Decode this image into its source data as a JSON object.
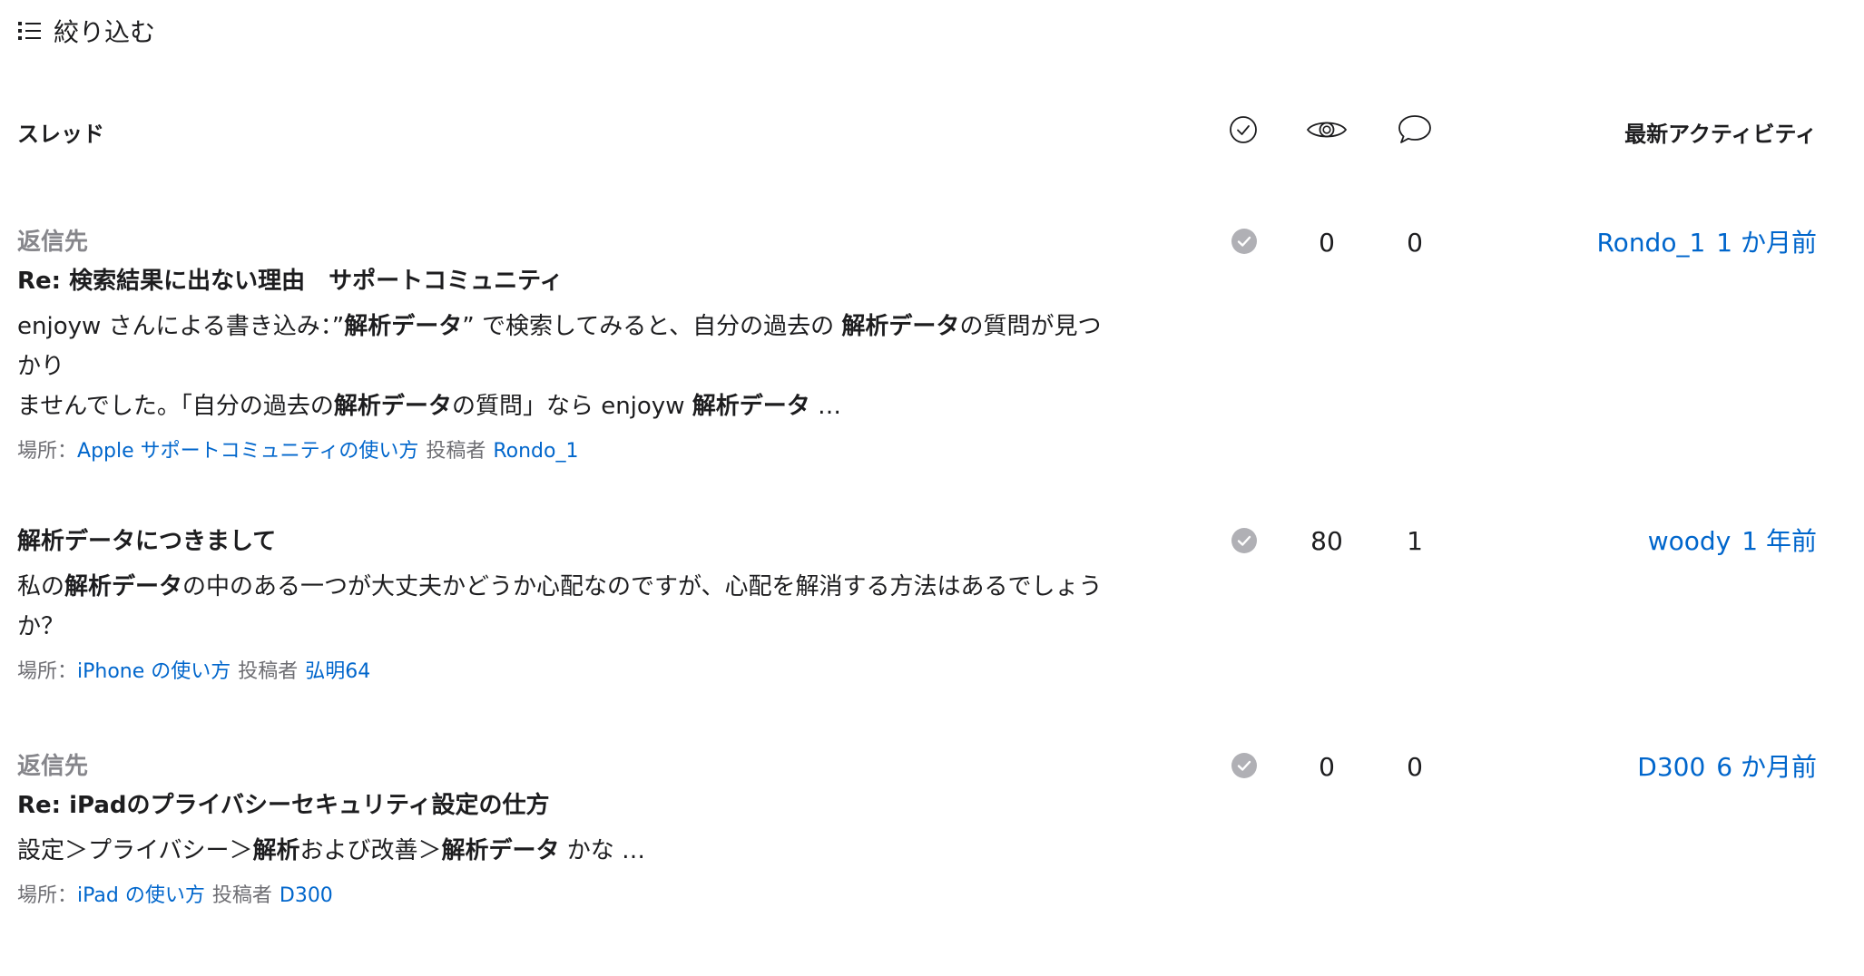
{
  "filter": {
    "label": "絞り込む",
    "icon": "list-filter-icon"
  },
  "header": {
    "thread": "スレッド",
    "solved_icon": "check-circle-icon",
    "views_icon": "eye-icon",
    "replies_icon": "speech-bubble-icon",
    "latest": "最新アクティビティ"
  },
  "colors": {
    "link": "#0066cc",
    "muted": "#86868b",
    "text": "#1d1d1f",
    "badge": "#b0b0b5"
  },
  "threads": [
    {
      "reply_to": "返信先",
      "title": "Re: 検索結果に出ない理由　サポートコミュニティ",
      "excerpt": [
        [
          "enjoyw さんによる書き込み：”",
          false
        ],
        [
          "解析データ",
          true
        ],
        [
          "” で検索してみると、自分の過去の ",
          false
        ],
        [
          "解析データ",
          true
        ],
        [
          "の質問が見つかり",
          false
        ],
        [
          "\nませんでした。「自分の過去の",
          false
        ],
        [
          "解析データ",
          true
        ],
        [
          "の質問」なら enjoyw ",
          false
        ],
        [
          "解析データ",
          true
        ],
        [
          " …",
          false
        ]
      ],
      "location_label": "場所：",
      "location": "Apple サポートコミュニティの使い方",
      "poster_label": "投稿者",
      "poster": "Rondo_1",
      "views": "0",
      "replies": "0",
      "latest_user": "Rondo_1",
      "latest_time": "1 か月前"
    },
    {
      "reply_to": "",
      "title": "解析データにつきまして",
      "excerpt": [
        [
          "私の",
          false
        ],
        [
          "解析データ",
          true
        ],
        [
          "の中のある一つが大丈夫かどうか心配なのですが、心配を解消する方法はあるでしょうか？",
          false
        ]
      ],
      "location_label": "場所：",
      "location": "iPhone の使い方",
      "poster_label": "投稿者",
      "poster": "弘明64",
      "views": "80",
      "replies": "1",
      "latest_user": "woody",
      "latest_time": "1 年前"
    },
    {
      "reply_to": "返信先",
      "title": "Re: iPadのプライバシーセキュリティ設定の仕方",
      "excerpt": [
        [
          "設定＞プライバシー＞",
          false
        ],
        [
          "解析",
          true
        ],
        [
          "および改善＞",
          false
        ],
        [
          "解析データ",
          true
        ],
        [
          " かな …",
          false
        ]
      ],
      "location_label": "場所：",
      "location": "iPad の使い方",
      "poster_label": "投稿者",
      "poster": "D300",
      "views": "0",
      "replies": "0",
      "latest_user": "D300",
      "latest_time": "6 か月前"
    }
  ]
}
